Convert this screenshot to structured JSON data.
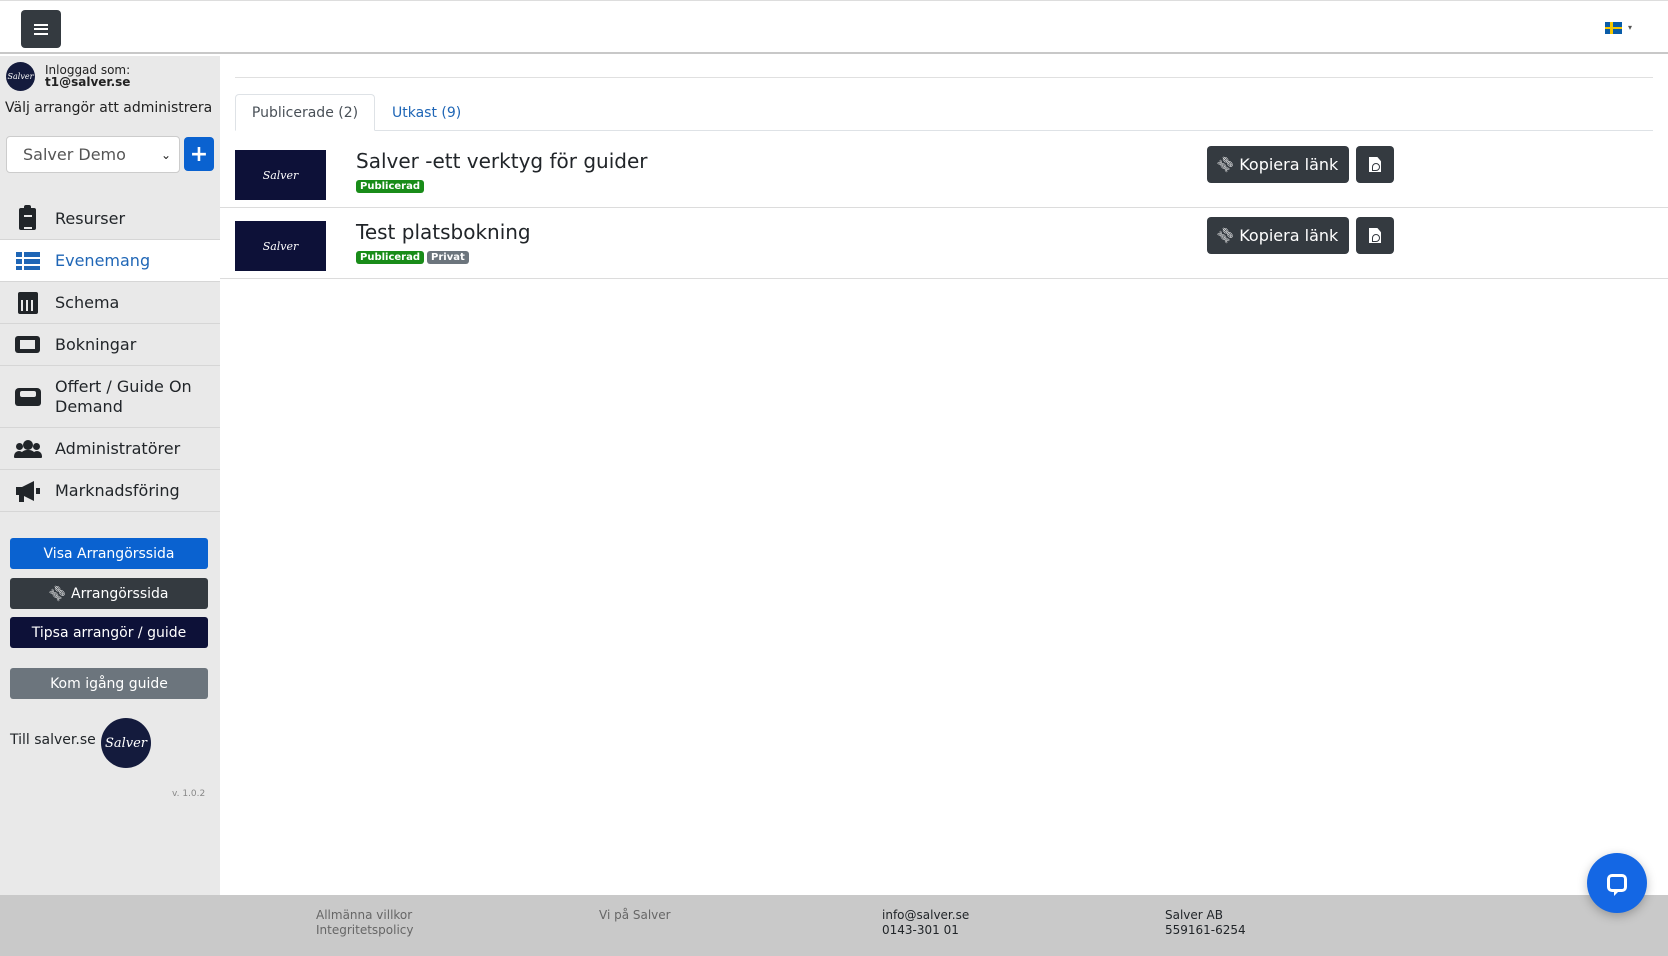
{
  "topbar": {
    "menu_icon": "hamburger-menu-icon",
    "language_icon": "sweden-flag-icon"
  },
  "sidebar": {
    "logged_in_label": "Inloggad som:",
    "user_email": "t1@salver.se",
    "avatar_text": "Salver",
    "choose_org_label": "Välj arrangör att administrera",
    "org_select_value": "Salver Demo",
    "add_org_label": "+",
    "nav": [
      {
        "label": "Resurser",
        "icon": "clipboard-icon",
        "active": false
      },
      {
        "label": "Evenemang",
        "icon": "list-icon",
        "active": true
      },
      {
        "label": "Schema",
        "icon": "calendar-icon",
        "active": false
      },
      {
        "label": "Bokningar",
        "icon": "ticket-icon",
        "active": false
      },
      {
        "label": "Offert / Guide On Demand",
        "icon": "inbox-icon",
        "active": false
      },
      {
        "label": "Administratörer",
        "icon": "users-icon",
        "active": false
      },
      {
        "label": "Marknadsföring",
        "icon": "megaphone-icon",
        "active": false
      }
    ],
    "buttons": {
      "show_page": "Visa Arrangörssida",
      "org_page_link": "Arrangörssida",
      "recommend": "Tipsa arrangör / guide",
      "get_started": "Kom igång guide"
    },
    "to_site_label": "Till salver.se",
    "logo_text": "Salver",
    "version": "v. 1.0.2"
  },
  "main": {
    "tabs": [
      {
        "label": "Publicerade (2)",
        "active": true
      },
      {
        "label": "Utkast (9)",
        "active": false
      }
    ],
    "events": [
      {
        "title": "Salver -ett verktyg för guider",
        "thumb_text": "Salver",
        "badges": [
          {
            "label": "Publicerad",
            "color": "#198c19"
          }
        ],
        "copy_label": "Kopiera länk"
      },
      {
        "title": "Test platsbokning",
        "thumb_text": "Salver",
        "badges": [
          {
            "label": "Publicerad",
            "color": "#198c19"
          },
          {
            "label": "Privat",
            "color": "#6c757d"
          }
        ],
        "copy_label": "Kopiera länk"
      }
    ]
  },
  "footer": {
    "col1": [
      "Allmänna villkor",
      "Integritetspolicy"
    ],
    "col2": [
      "Vi på Salver"
    ],
    "col3": [
      "info@salver.se",
      "0143-301 01"
    ],
    "col4": [
      "Salver AB",
      "559161-6254"
    ]
  },
  "colors": {
    "accent_blue": "#0a62d0",
    "active_nav": "#1f66b6",
    "dark_button": "#343a40",
    "navy": "#0d1138",
    "badge_green": "#198c19",
    "footer_bg": "#c9c9c9"
  }
}
